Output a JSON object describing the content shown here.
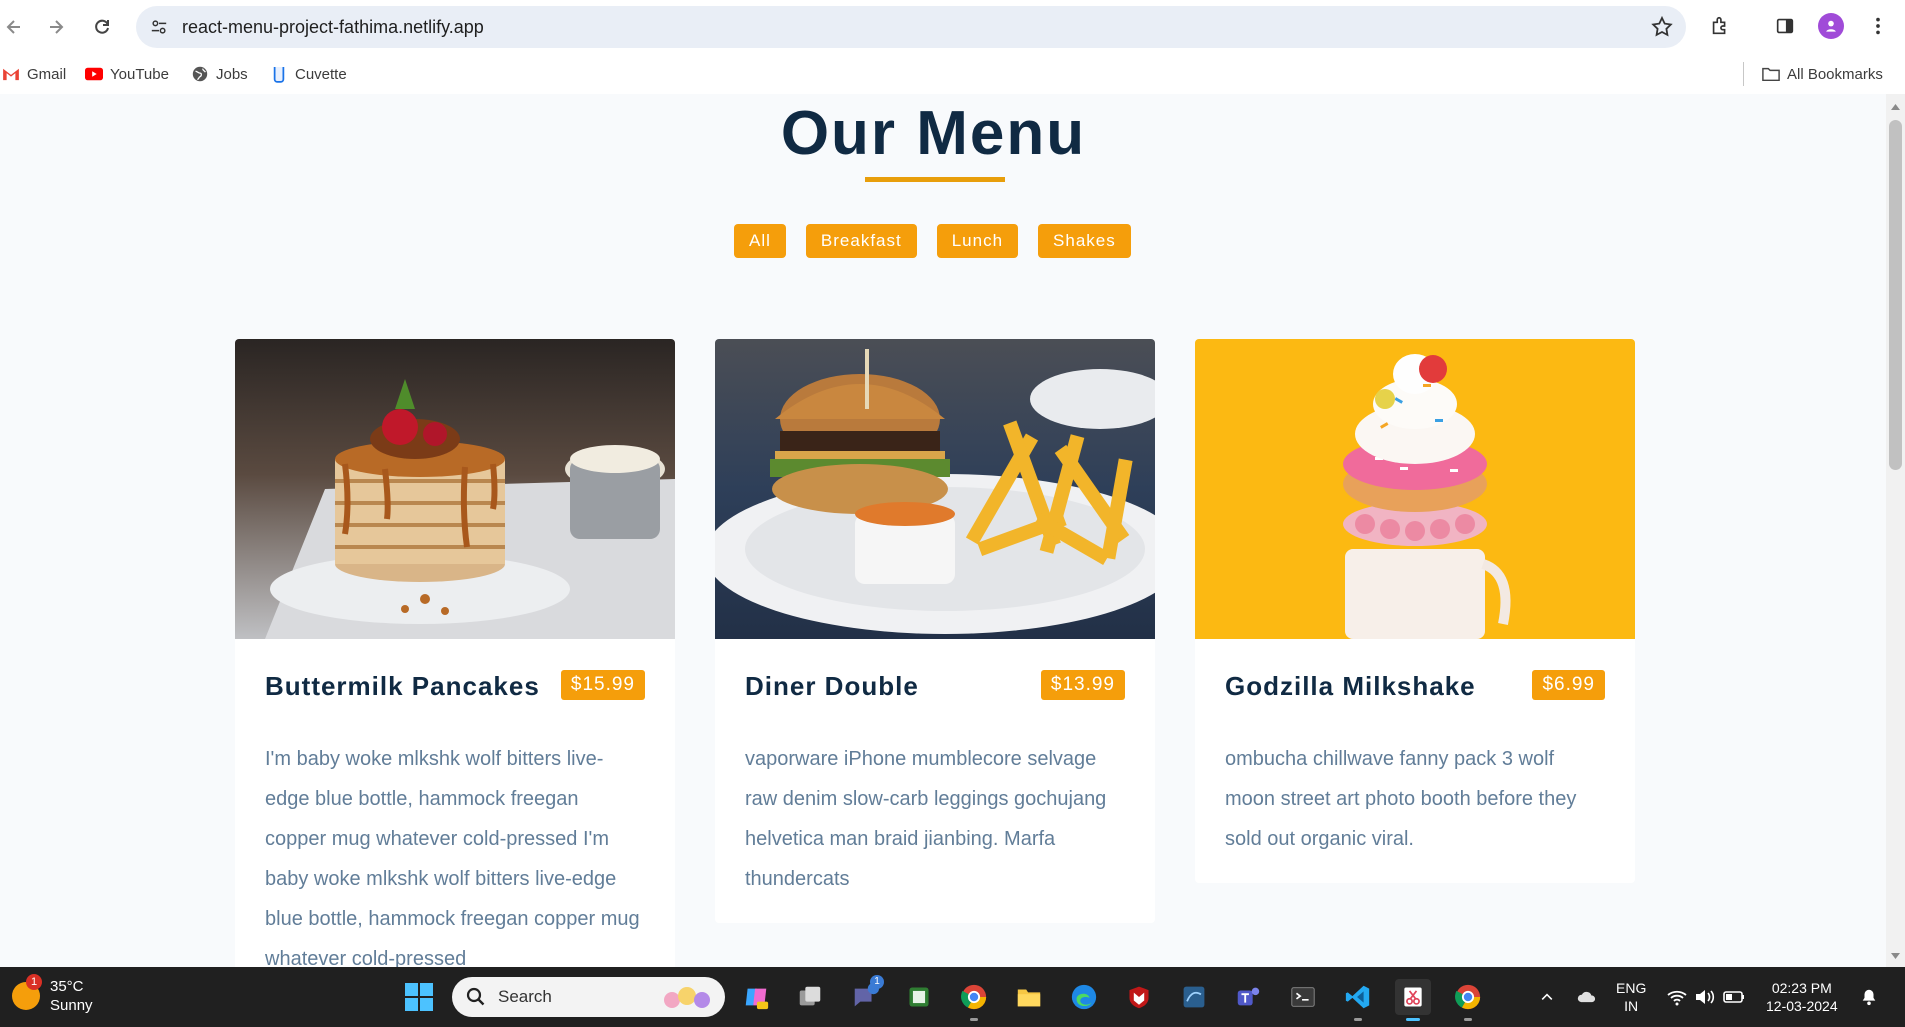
{
  "browser": {
    "url": "react-menu-project-fathima.netlify.app",
    "bookmarks": [
      {
        "label": "Gmail",
        "icon": "gmail-icon"
      },
      {
        "label": "YouTube",
        "icon": "youtube-icon"
      },
      {
        "label": "Jobs",
        "icon": "globe-icon"
      },
      {
        "label": "Cuvette",
        "icon": "cuvette-icon"
      }
    ],
    "all_bookmarks_label": "All Bookmarks"
  },
  "page": {
    "title": "Our Menu",
    "accent_color": "#f59e0b",
    "filters": [
      "All",
      "Breakfast",
      "Lunch",
      "Shakes"
    ],
    "items": [
      {
        "name": "Buttermilk Pancakes",
        "price": "$15.99",
        "image": "pancakes-photo",
        "description": "I'm baby woke mlkshk wolf bitters live-edge blue bottle, hammock freegan copper mug whatever cold-pressed I'm baby woke mlkshk wolf bitters live-edge blue bottle, hammock freegan copper mug whatever cold-pressed"
      },
      {
        "name": "Diner Double",
        "price": "$13.99",
        "image": "burger-photo",
        "description": "vaporware iPhone mumblecore selvage raw denim slow-carb leggings gochujang helvetica man braid jianbing. Marfa thundercats"
      },
      {
        "name": "Godzilla Milkshake",
        "price": "$6.99",
        "image": "milkshake-photo",
        "description": "ombucha chillwave fanny pack 3 wolf moon street art photo booth before they sold out organic viral."
      }
    ]
  },
  "taskbar": {
    "weather_temp": "35°C",
    "weather_condition": "Sunny",
    "weather_badge": "1",
    "search_label": "Search",
    "teams_badge": "1",
    "language": "ENG",
    "region": "IN",
    "time": "02:23 PM",
    "date": "12-03-2024"
  }
}
